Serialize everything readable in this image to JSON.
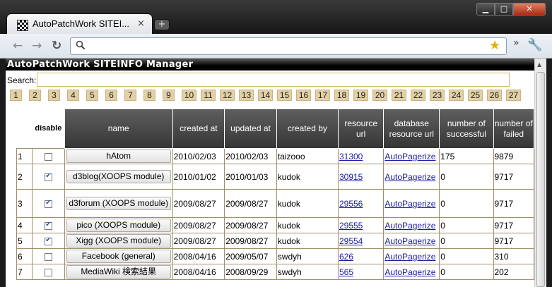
{
  "browser": {
    "tab_title": "AutoPatchWork SITEI...",
    "tab_close": "×",
    "new_tab": "+",
    "min": "▁",
    "max": "□",
    "close": "✕",
    "back": "←",
    "forward": "→",
    "reload": "↻",
    "address": "",
    "icons": [
      "favicon-icon",
      "back-icon",
      "forward-icon",
      "reload-icon",
      "search-icon",
      "star-icon",
      "chevron-icon",
      "wrench-icon"
    ]
  },
  "page": {
    "header": "AutoPatchWork SITEINFO Manager",
    "search_label": "Search:",
    "search_value": "",
    "pages": [
      "1",
      "2",
      "3",
      "4",
      "5",
      "6",
      "7",
      "8",
      "9",
      "10",
      "11",
      "12",
      "13",
      "14",
      "15",
      "16",
      "17",
      "18",
      "19",
      "20",
      "21",
      "22",
      "23",
      "24",
      "25",
      "26",
      "27"
    ],
    "columns": {
      "disable": "disable",
      "name": "name",
      "created": "created at",
      "updated": "updated at",
      "created_by": "created by",
      "resource_url": "resource url",
      "db_url": "database resource url",
      "successful": "number of successful",
      "failed": "number of failed"
    },
    "rows": [
      {
        "n": "1",
        "checked": false,
        "name": "hAtom",
        "created": "2010/02/03",
        "updated": "2010/02/03",
        "by": "taizooo",
        "res": "31300",
        "db": "AutoPagerize",
        "succ": "175",
        "fail": "9879"
      },
      {
        "n": "2",
        "checked": true,
        "name": "d3blog(XOOPS module)",
        "created": "2010/01/02",
        "updated": "2010/01/03",
        "by": "kudok",
        "res": "30915",
        "db": "AutoPagerize",
        "succ": "0",
        "fail": "9717"
      },
      {
        "n": "3",
        "checked": true,
        "name": "d3forum (XOOPS module)",
        "created": "2009/08/27",
        "updated": "2009/08/27",
        "by": "kudok",
        "res": "29556",
        "db": "AutoPagerize",
        "succ": "0",
        "fail": "9717"
      },
      {
        "n": "4",
        "checked": true,
        "name": "pico (XOOPS module)",
        "created": "2009/08/27",
        "updated": "2009/08/27",
        "by": "kudok",
        "res": "29555",
        "db": "AutoPagerize",
        "succ": "0",
        "fail": "9717"
      },
      {
        "n": "5",
        "checked": true,
        "name": "Xigg (XOOPS module)",
        "created": "2009/08/27",
        "updated": "2009/08/27",
        "by": "kudok",
        "res": "29554",
        "db": "AutoPagerize",
        "succ": "0",
        "fail": "9717"
      },
      {
        "n": "6",
        "checked": false,
        "name": "Facebook (general)",
        "created": "2008/04/16",
        "updated": "2009/05/07",
        "by": "swdyh",
        "res": "626",
        "db": "AutoPagerize",
        "succ": "0",
        "fail": "310"
      },
      {
        "n": "7",
        "checked": false,
        "name": "MediaWiki 検索結果",
        "created": "2008/04/16",
        "updated": "2008/09/29",
        "by": "swdyh",
        "res": "565",
        "db": "AutoPagerize",
        "succ": "0",
        "fail": "202"
      }
    ]
  }
}
